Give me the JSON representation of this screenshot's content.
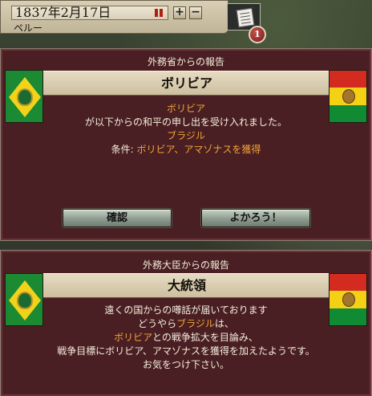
{
  "topbar": {
    "date": "1837年2月17日",
    "country": "ペルー",
    "speed_plus": "+",
    "speed_minus": "−",
    "message_count": "1"
  },
  "dialog1": {
    "source": "外務省からの報告",
    "title": "ボリビア",
    "line_country": "ボリビア",
    "line_accept": "が以下からの和平の申し出を受け入れました。",
    "line_from": "ブラジル",
    "terms_label": "条件: ",
    "terms_value": "ボリビア、アマゾナスを獲得",
    "btn_confirm": "確認",
    "btn_ok": "よかろう！"
  },
  "dialog2": {
    "source": "外務大臣からの報告",
    "title": "大統領",
    "line1": "遠くの国からの噂話が届いております",
    "line2_pre": "どうやら",
    "line2_hl": "ブラジル",
    "line2_post": "は、",
    "line3_hl": "ボリビア",
    "line3_post": "との戦争拡大を目論み、",
    "line4": "戦争目標にボリビア、アマゾナスを獲得を加えたようです。",
    "line5": "お気をつけ下さい。"
  },
  "flags": {
    "left": "brazil-flag",
    "right": "bolivia-flag"
  },
  "colors": {
    "panel_bg": "#4a1f23",
    "highlight": "#f0a43a",
    "header_bg": "#e6dcc3"
  }
}
